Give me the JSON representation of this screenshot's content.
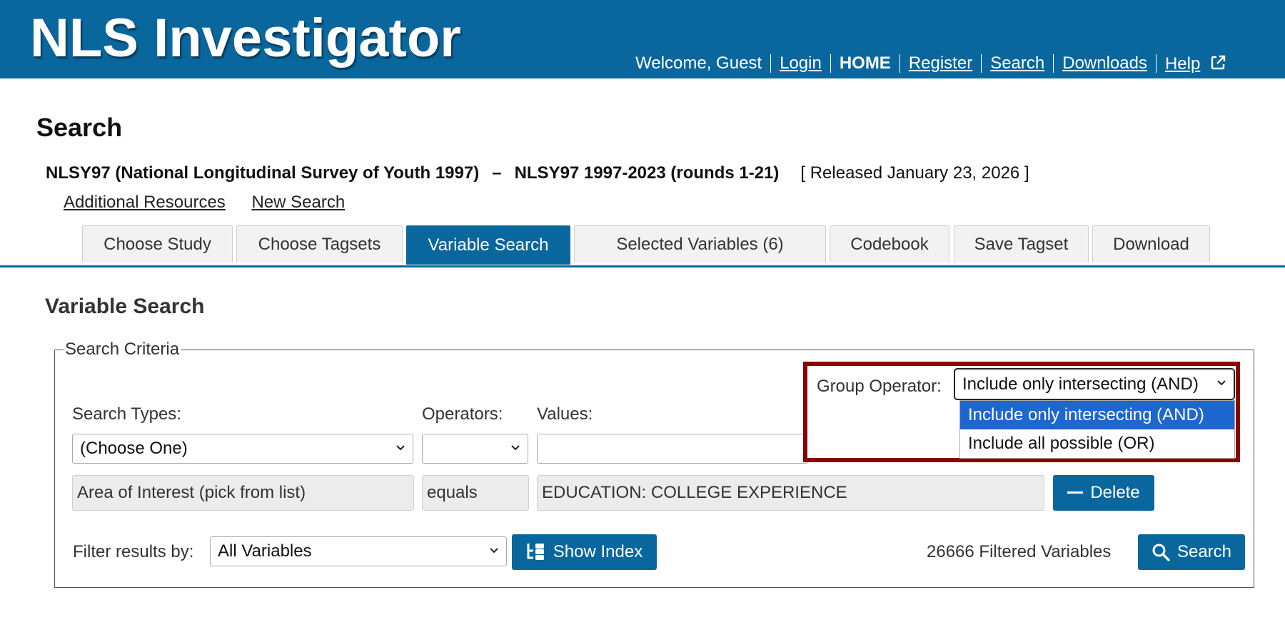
{
  "header": {
    "app_title": "NLS Investigator",
    "welcome": "Welcome, Guest",
    "nav": [
      "Login",
      "HOME",
      "Register",
      "Search",
      "Downloads",
      "Help"
    ]
  },
  "page": {
    "title": "Search",
    "study": "NLSY97 (National Longitudinal Survey of Youth 1997)",
    "dash": "–",
    "release": "NLSY97 1997-2023 (rounds 1-21)",
    "released": "[ Released January 23, 2026 ]",
    "links": [
      "Additional Resources",
      "New Search"
    ]
  },
  "tabs": [
    "Choose Study",
    "Choose Tagsets",
    "Variable Search",
    "Selected Variables (6)",
    "Codebook",
    "Save Tagset",
    "Download"
  ],
  "variable_search": {
    "title": "Variable Search",
    "legend": "Search Criteria",
    "group_operator_label": "Group Operator:",
    "group_operator_value": "Include only intersecting (AND)",
    "group_operator_options": [
      "Include only intersecting (AND)",
      "Include all possible (OR)"
    ],
    "search_types_label": "Search Types:",
    "operators_label": "Operators:",
    "values_label": "Values:",
    "search_type_value": "(Choose One)",
    "operator_value": "",
    "values_value": "",
    "criterion": {
      "type": "Area of Interest (pick from list)",
      "operator": "equals",
      "value": "EDUCATION: COLLEGE EXPERIENCE",
      "delete_label": "Delete"
    },
    "filter_label": "Filter results by:",
    "filter_value": "All Variables",
    "show_index_label": "Show Index",
    "filtered_count": "26666 Filtered Variables",
    "search_label": "Search"
  },
  "colors": {
    "brand": "#0a679e",
    "highlight": "#8b0000",
    "option_selected": "#1e66d0"
  }
}
